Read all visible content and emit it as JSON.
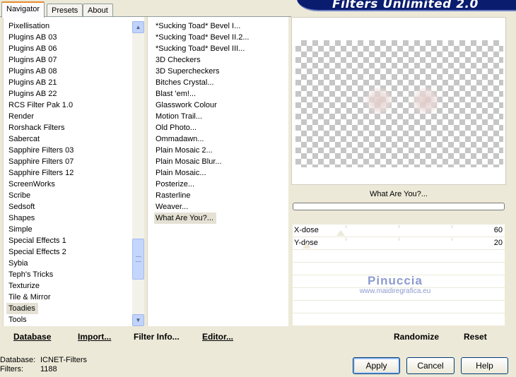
{
  "tabs": [
    "Navigator",
    "Presets",
    "About"
  ],
  "banner_title": "Filters Unlimited 2.0",
  "categories": [
    "Pixellisation",
    "Plugins AB 03",
    "Plugins AB 06",
    "Plugins AB 07",
    "Plugins AB 08",
    "Plugins AB 21",
    "Plugins AB 22",
    "RCS Filter Pak 1.0",
    "Render",
    "Rorshack Filters",
    "Sabercat",
    "Sapphire Filters 03",
    "Sapphire Filters 07",
    "Sapphire Filters 12",
    "ScreenWorks",
    "Scribe",
    "Sedsoft",
    "Shapes",
    "Simple",
    "Special Effects 1",
    "Special Effects 2",
    "Sybia",
    "Teph's Tricks",
    "Texturize",
    "Tile & Mirror",
    "Toadies",
    "Tools"
  ],
  "selected_category": "Toadies",
  "filters": [
    "*Sucking Toad*  Bevel I...",
    "*Sucking Toad*  Bevel II.2...",
    "*Sucking Toad*  Bevel III...",
    "3D Checkers",
    "3D Supercheckers",
    "Bitches Crystal...",
    "Blast 'em!...",
    "Glasswork Colour",
    "Motion Trail...",
    "Old Photo...",
    "Ommadawn...",
    "Plain Mosaic 2...",
    "Plain Mosaic Blur...",
    "Plain Mosaic...",
    "Posterize...",
    "Rasterline",
    "Weaver...",
    "What Are You?..."
  ],
  "selected_filter": "What Are You?...",
  "preview": {
    "filter_name": "What Are You?..."
  },
  "sliders": [
    {
      "label": "X-dose",
      "value": "60"
    },
    {
      "label": "Y-dose",
      "value": "20"
    }
  ],
  "watermark": {
    "title": "Pinuccia",
    "url": "www.maidiregrafica.eu"
  },
  "commands": {
    "database": "Database",
    "import": "Import...",
    "filter_info": "Filter Info...",
    "editor": "Editor...",
    "randomize": "Randomize",
    "reset": "Reset"
  },
  "status": {
    "database_label": "Database:",
    "database_value": "ICNET-Filters",
    "filters_label": "Filters:",
    "filters_value": "1188"
  },
  "buttons": {
    "apply": "Apply",
    "cancel": "Cancel",
    "help": "Help"
  },
  "icons": {
    "scroll_up": "chevron-up-icon",
    "scroll_down": "chevron-down-icon"
  },
  "colors": {
    "banner": "#0a1c6e",
    "tab_highlight": "#e68b2c",
    "button_border": "#003c74"
  }
}
